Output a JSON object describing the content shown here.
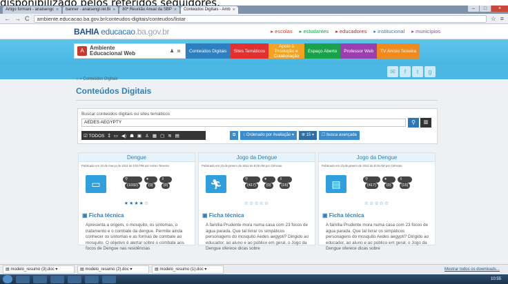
{
  "caption": "disponibilizado pelos referidos seguidores.",
  "browser": {
    "tabs": [
      {
        "label": "Artigo formani - anaisengc"
      },
      {
        "label": "banner - anaisengl.rel.Bi"
      },
      {
        "label": "80º Reunião Anual da SBP"
      },
      {
        "label": "Conteúdos Digitais - Amb"
      }
    ],
    "url": "ambiente.educacao.ba.gov.br/conteudos-digitais/conteudos/listar"
  },
  "site": {
    "logo_bahia": "BAHIA",
    "logo_educacao": "educacao",
    "logo_domain": ".ba.gov.br",
    "links": [
      "escolas",
      "estudantes",
      "educadores",
      "institucional",
      "municípios"
    ],
    "brand_line1": "Ambiente",
    "brand_line2": "Educacional Web",
    "menu": [
      {
        "label": "Conteúdos Digitais",
        "color": "#2e7fbf"
      },
      {
        "label": "Sites Temáticos",
        "color": "#e0302f"
      },
      {
        "label": "Apoio à Produção e Colaboração",
        "color": "#f3a321"
      },
      {
        "label": "Espaço Aberto",
        "color": "#1aa24b"
      },
      {
        "label": "Professor Web",
        "color": "#9b3fb0"
      },
      {
        "label": "TV Anísio Teixeira",
        "color": "#f08a1c"
      }
    ]
  },
  "breadcrumb": "» Conteúdos Digitais",
  "page_title": "Conteúdos Digitais",
  "search": {
    "label": "Buscar conteúdos digitais ou sites temáticos",
    "value": "AEDES AEGYPTY",
    "filter_all": "TODOS",
    "sort_label": "Ordenado por Avaliação",
    "per_page": "15",
    "advanced": "busca avançada"
  },
  "cards": [
    {
      "title": "Dengue",
      "meta": "Publicado em 10 de março de 2011 às 5:04 PM por Anísio Teixeira",
      "views": "(1032)",
      "comments": "(0)",
      "downloads": "(0)",
      "stars": "★★★★☆",
      "ficha": "Ficha técnica",
      "desc": "Apresenta a origem, o mosquito, os sintomas, o tratamento e o combate da dengue. Permite ainda conhecer os sintomas e as formas de combate ao mosquito. O objetivo é alertar sobre o combate aos focos de Dengue nas residências"
    },
    {
      "title": "Jogo da Dengue",
      "meta": "Publicado em 23 de janeiro de 2012 às 8:25 AM por Ciências",
      "views": "(417)",
      "comments": "(0)",
      "downloads": "(15)",
      "stars": "☆☆☆☆☆",
      "ficha": "Ficha técnica",
      "desc": "A família Prudente mora numa casa com 23 focos de água parada. Que tal livrar os simpáticos personagens do mosquito Aedes aegypti? Dirigido ao educador, ao aluno e ao público em geral, o Jogo da Dengue oferece dicas sobre"
    },
    {
      "title": "Jogo da Dengue",
      "meta": "Publicado em 23 de janeiro de 2012 às 8:25 AM por Ciências",
      "views": "(417)",
      "comments": "(0)",
      "downloads": "(15)",
      "stars": "☆☆☆☆☆",
      "ficha": "Ficha técnica",
      "desc": "A família Prudente mora numa casa com 23 focos de água parada. Que tal livrar os simpáticos personagens do mosquito Aedes aegypti? Dirigido ao educador, ao aluno e ao público em geral, o Jogo da Dengue oferece dicas sobre"
    }
  ],
  "downloads": {
    "files": [
      "modelo_resumo (3).doc",
      "modelo_resumo (2).doc",
      "modelo_resumo (1).doc"
    ],
    "show_all": "Mostrar todos os downloads..."
  },
  "taskbar": {
    "clock": "10:55"
  }
}
